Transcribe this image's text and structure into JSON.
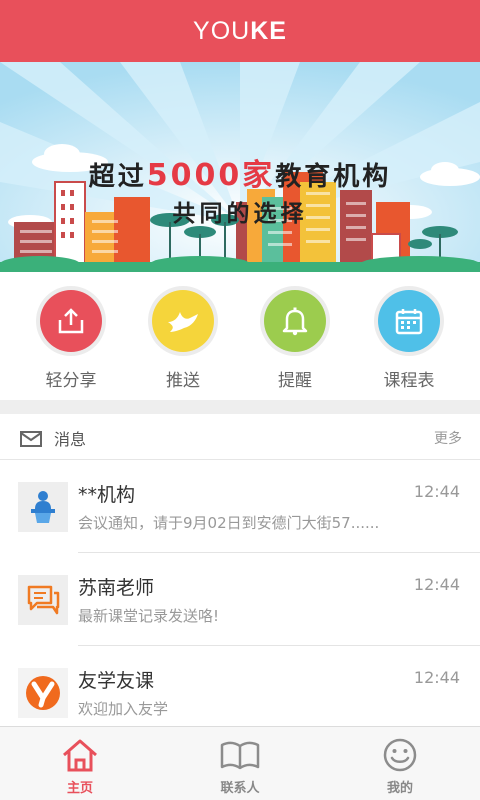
{
  "header": {
    "title_part1": "YOU",
    "title_part2": "KE"
  },
  "banner": {
    "line1_before": "超过",
    "line1_highlight": "5000家",
    "line1_after": "教育机构",
    "line2": "共同的选择"
  },
  "actions": [
    {
      "label": "轻分享",
      "icon": "share-upload-icon",
      "color": "#e8505b"
    },
    {
      "label": "推送",
      "icon": "bird-icon",
      "color": "#f5d53b"
    },
    {
      "label": "提醒",
      "icon": "bell-icon",
      "color": "#9ccc4e"
    },
    {
      "label": "课程表",
      "icon": "calendar-icon",
      "color": "#4fc0e8"
    }
  ],
  "messages_header": {
    "title": "消息",
    "more": "更多"
  },
  "messages": [
    {
      "name": "**机构",
      "time": "12:44",
      "preview": "会议通知，请于9月02日到安德门大街57......",
      "icon": "podium-speaker-icon"
    },
    {
      "name": "苏南老师",
      "time": "12:44",
      "preview": "最新课堂记录发送咯!",
      "icon": "chat-bubbles-icon"
    },
    {
      "name": "友学友课",
      "time": "12:44",
      "preview": "欢迎加入友学",
      "icon": "youke-logo-icon"
    }
  ],
  "bottom_nav": [
    {
      "label": "主页",
      "icon": "home-icon",
      "active": true
    },
    {
      "label": "联系人",
      "icon": "book-icon",
      "active": false
    },
    {
      "label": "我的",
      "icon": "smiley-icon",
      "active": false
    }
  ],
  "colors": {
    "brand": "#e8505b",
    "banner_sky": "#bfe6f6",
    "accent_text": "#e53a45"
  }
}
